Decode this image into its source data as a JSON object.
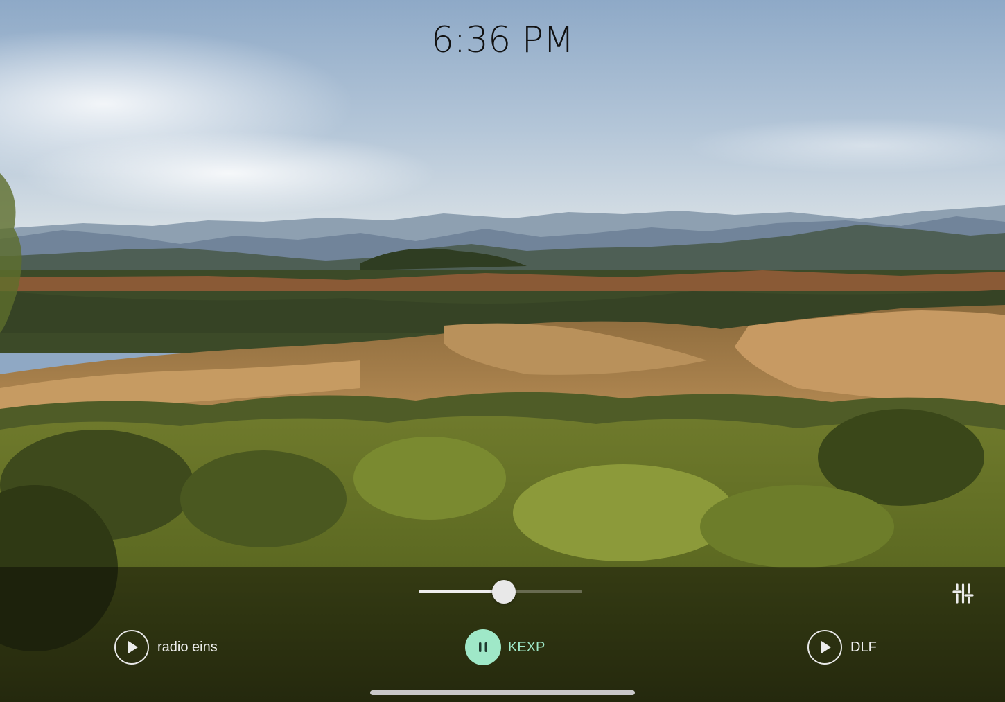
{
  "clock": {
    "time": "6:36 PM"
  },
  "player": {
    "volume": 0.52,
    "accent_color": "#9fe8c8",
    "stations": [
      {
        "name": "radio eins",
        "state": "stopped",
        "icon": "play-icon"
      },
      {
        "name": "KEXP",
        "state": "playing",
        "icon": "pause-icon"
      },
      {
        "name": "DLF",
        "state": "stopped",
        "icon": "play-icon"
      }
    ],
    "settings_icon": "equalizer-sliders-icon"
  }
}
